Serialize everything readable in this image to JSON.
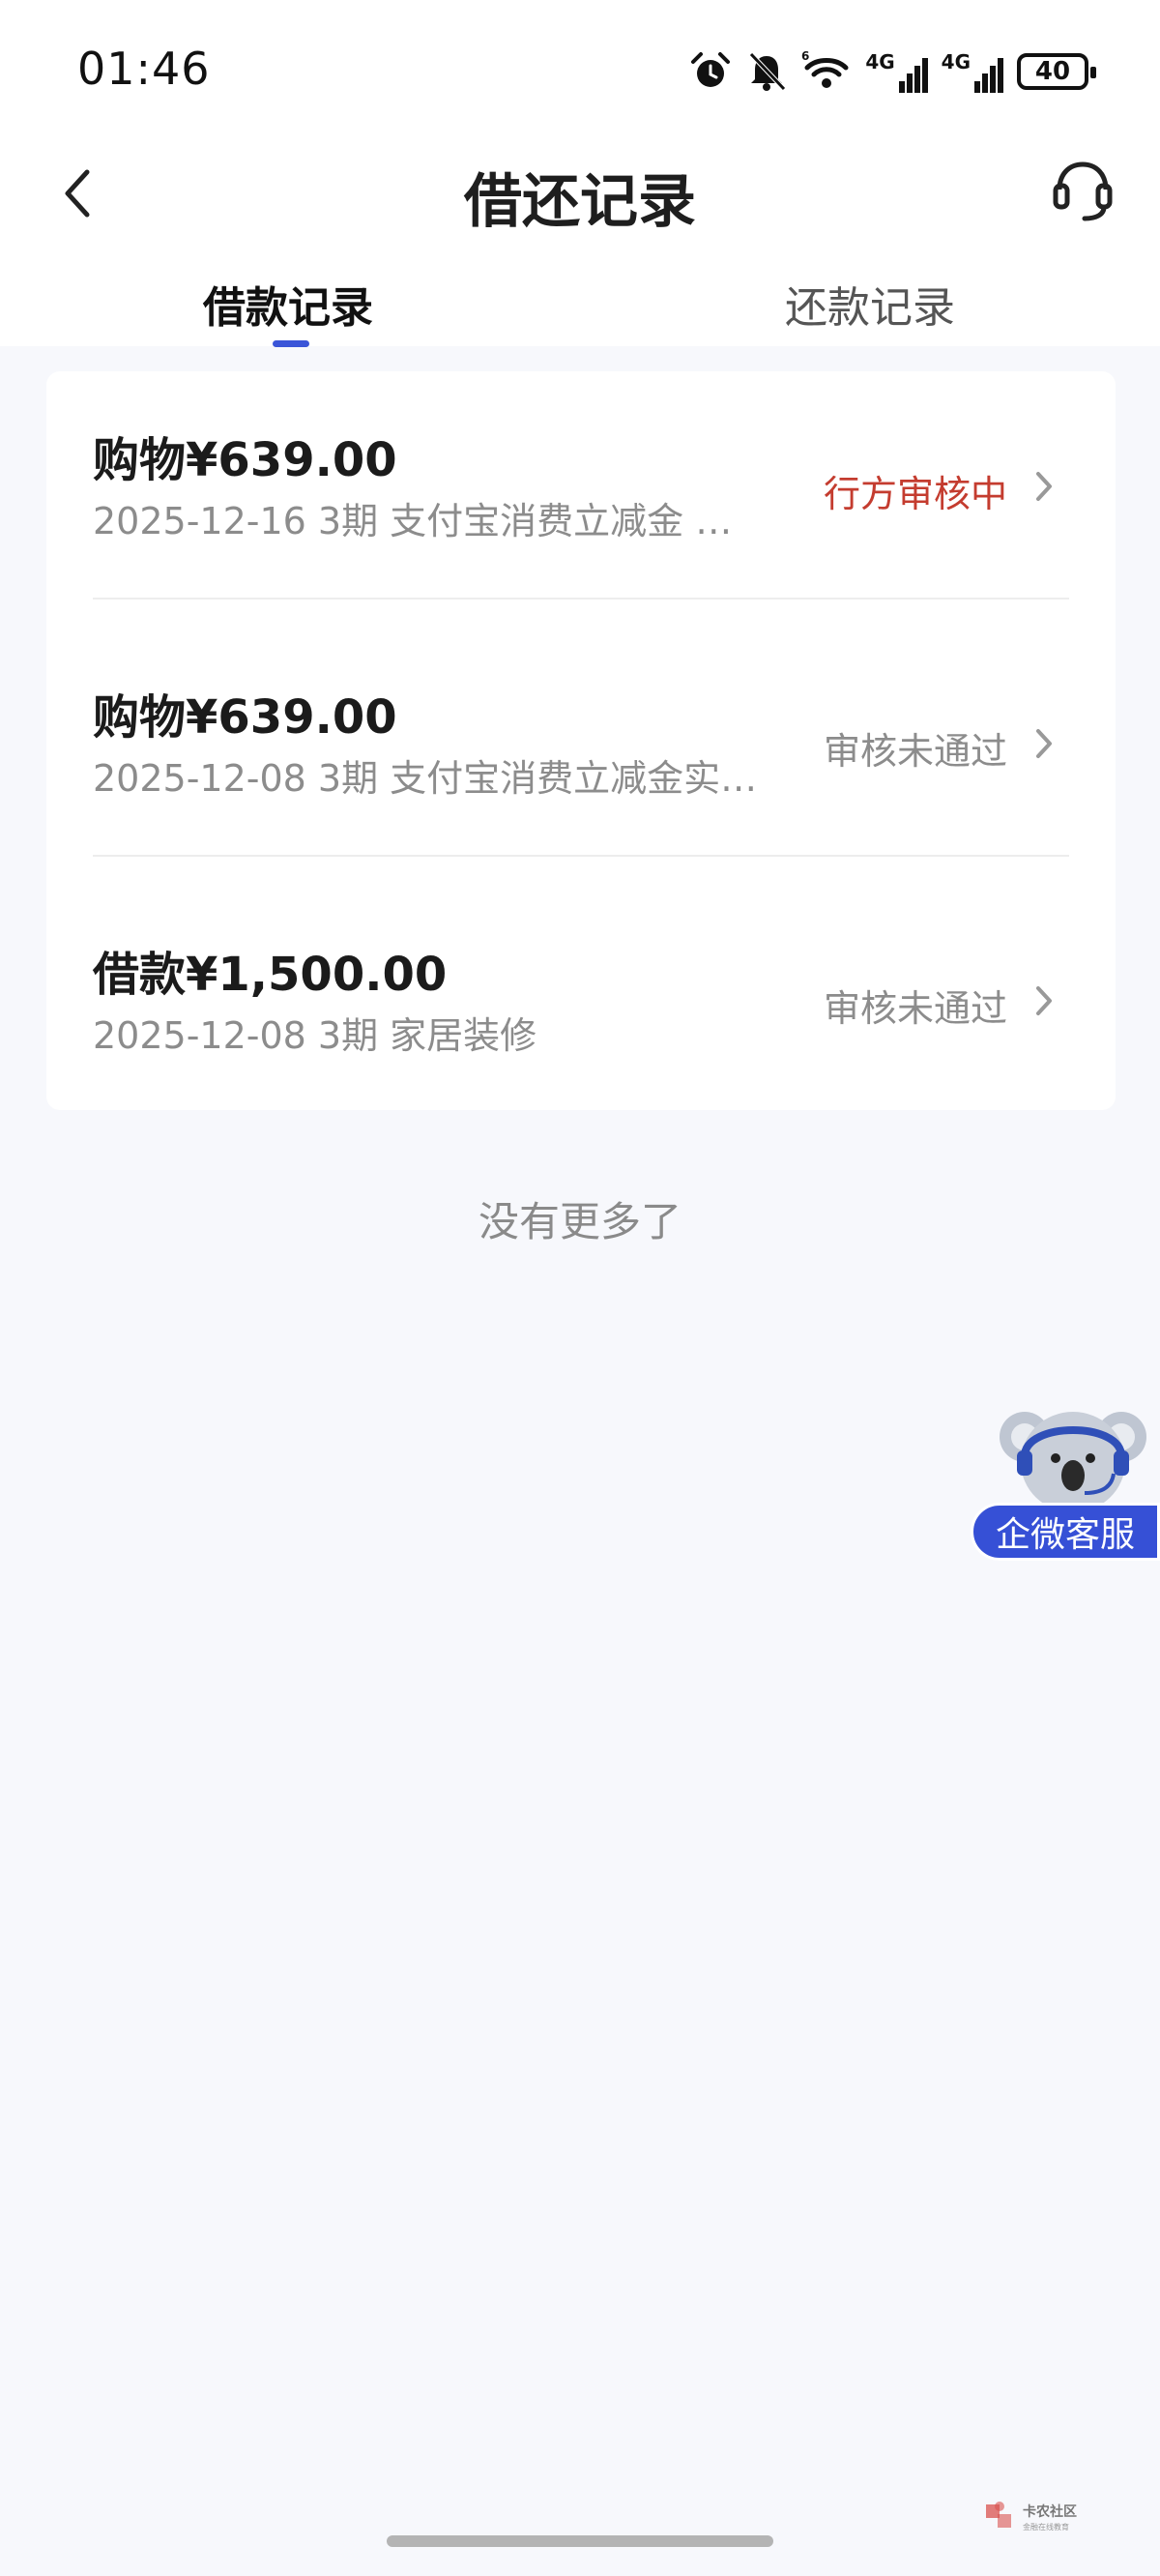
{
  "status_bar": {
    "time": "01:46",
    "icons": [
      "alarm-icon",
      "mute-icon",
      "wifi-icon",
      "signal-4g-icon",
      "signal-4g-icon",
      "battery-icon"
    ],
    "wifi_label": "6",
    "sim1_label": "4G",
    "sim2_label": "4G",
    "battery_level": "40"
  },
  "header": {
    "title": "借还记录",
    "back_icon": "chevron-left-icon",
    "service_icon": "headset-icon"
  },
  "tabs": [
    {
      "label": "借款记录",
      "active": true
    },
    {
      "label": "还款记录",
      "active": false
    }
  ],
  "records": [
    {
      "amount": "购物¥639.00",
      "meta": "2025-12-16 3期  支付宝消费立减金 …",
      "status": "行方审核中",
      "status_color": "#c43c2f"
    },
    {
      "amount": "购物¥639.00",
      "meta": "2025-12-08 3期  支付宝消费立减金实…",
      "status": "审核未通过",
      "status_color": "#8c8c8c"
    },
    {
      "amount": "借款¥1,500.00",
      "meta": "2025-12-08 3期  家居装修",
      "status": "审核未通过",
      "status_color": "#8c8c8c"
    }
  ],
  "footer_text": "没有更多了",
  "float_service": {
    "label": "企微客服",
    "icon": "koala-mascot-icon"
  },
  "watermark": {
    "text": "卡农社区",
    "subtext": "金融在线教育"
  },
  "colors": {
    "accent": "#3a55d8",
    "pending": "#c43c2f",
    "rejected": "#8c8c8c",
    "background": "#f7f8fc"
  }
}
